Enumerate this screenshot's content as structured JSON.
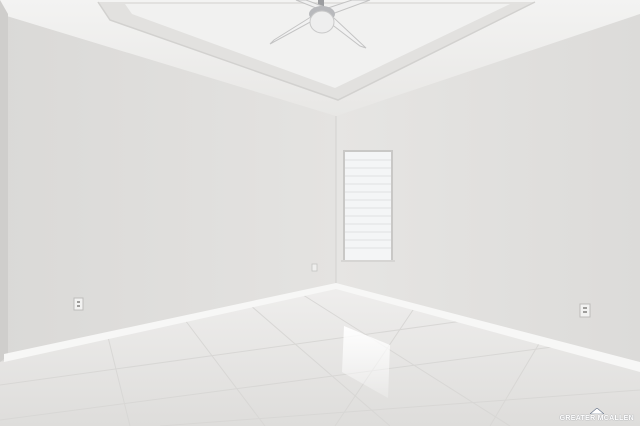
{
  "watermark": {
    "text": "GREATER MCALLEN"
  },
  "colors": {
    "left_wall": "#dedddb",
    "right_wall": "#e3e2e0",
    "ceiling": "#efeeed",
    "floor": "#e6e5e3",
    "baseboard": "#f6f6f5",
    "window_blind": "#f4f5f6"
  },
  "icons": {
    "ceiling_fan": "ceiling-fan-icon",
    "outlet": "outlet-icon"
  }
}
